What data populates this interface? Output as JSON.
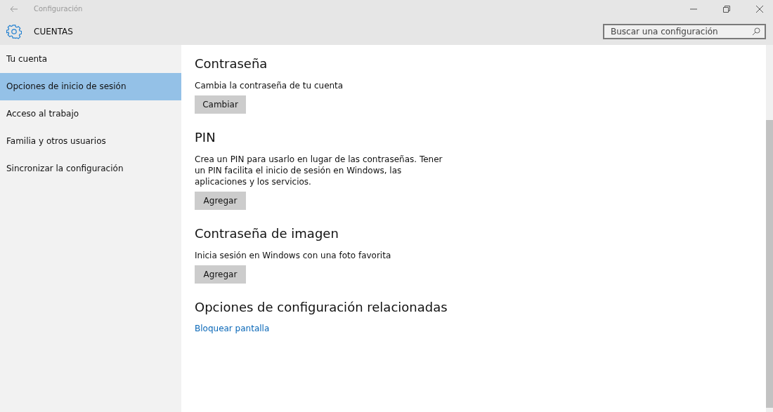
{
  "window": {
    "title": "Configuración"
  },
  "header": {
    "title": "CUENTAS"
  },
  "search": {
    "placeholder": "Buscar una configuración"
  },
  "sidebar": {
    "items": [
      {
        "label": "Tu cuenta",
        "selected": false
      },
      {
        "label": "Opciones de inicio de sesión",
        "selected": true
      },
      {
        "label": "Acceso al trabajo",
        "selected": false
      },
      {
        "label": "Familia y otros usuarios",
        "selected": false
      },
      {
        "label": "Sincronizar la configuración",
        "selected": false
      }
    ]
  },
  "sections": [
    {
      "title": "Contraseña",
      "description": "Cambia la contraseña de tu cuenta",
      "action": {
        "kind": "button",
        "label": "Cambiar"
      }
    },
    {
      "title": "PIN",
      "description": "Crea un PIN para usarlo en lugar de las contraseñas. Tener un PIN facilita el inicio de sesión en Windows, las aplicaciones y los servicios.",
      "action": {
        "kind": "button",
        "label": "Agregar"
      }
    },
    {
      "title": "Contraseña de imagen",
      "description": "Inicia sesión en Windows con una foto favorita",
      "action": {
        "kind": "button",
        "label": "Agregar"
      }
    },
    {
      "title": "Opciones de configuración relacionadas",
      "action": {
        "kind": "link",
        "label": "Bloquear pantalla"
      }
    }
  ]
}
